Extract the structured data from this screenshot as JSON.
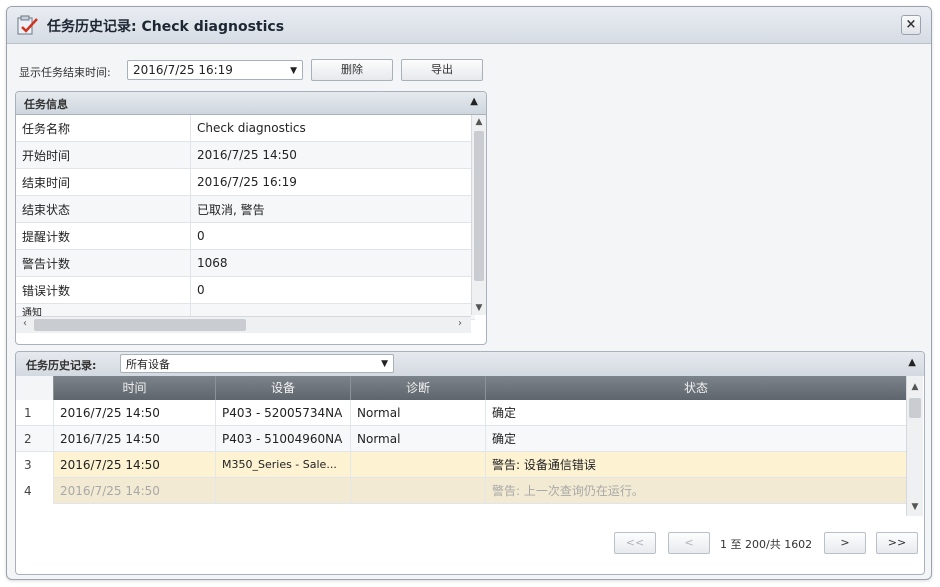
{
  "window": {
    "title": "任务历史记录: Check diagnostics",
    "close": "×"
  },
  "toolbar": {
    "filter_label": "显示任务结束时间:",
    "selected_time": "2016/7/25 16:19",
    "delete_label": "删除",
    "export_label": "导出"
  },
  "task_info": {
    "title": "任务信息",
    "rows": [
      {
        "key": "任务名称",
        "value": "Check diagnostics"
      },
      {
        "key": "开始时间",
        "value": "2016/7/25 14:50"
      },
      {
        "key": "结束时间",
        "value": "2016/7/25 16:19"
      },
      {
        "key": "结束状态",
        "value": "已取消, 警告"
      },
      {
        "key": "提醒计数",
        "value": "0"
      },
      {
        "key": "警告计数",
        "value": "1068"
      },
      {
        "key": "错误计数",
        "value": "0"
      },
      {
        "key": "通知",
        "value": ""
      }
    ]
  },
  "history": {
    "title": "任务历史记录:",
    "filter_value": "所有设备",
    "columns": [
      "时间",
      "设备",
      "诊断",
      "状态"
    ],
    "rows": [
      {
        "num": "1",
        "time": "2016/7/25 14:50",
        "device": "P403 - 52005734NA",
        "diag": "Normal",
        "status": "确定"
      },
      {
        "num": "2",
        "time": "2016/7/25 14:50",
        "device": "P403 - 51004960NA",
        "diag": "Normal",
        "status": "确定"
      },
      {
        "num": "3",
        "time": "2016/7/25 14:50",
        "device": "M350_Series - Sale...",
        "diag": "",
        "status": "警告: 设备通信错误"
      },
      {
        "num": "4",
        "time": "2016/7/25 14:50",
        "device": "",
        "diag": "",
        "status": "警告: 上一次查询仍在运行。"
      }
    ]
  },
  "pager": {
    "first": "<<",
    "prev": "<",
    "range_text": "1 至 200/共 1602",
    "next": ">",
    "last": ">>"
  },
  "colors": {
    "accent": "#5f656c",
    "warning_row": "#fdf3d2"
  }
}
